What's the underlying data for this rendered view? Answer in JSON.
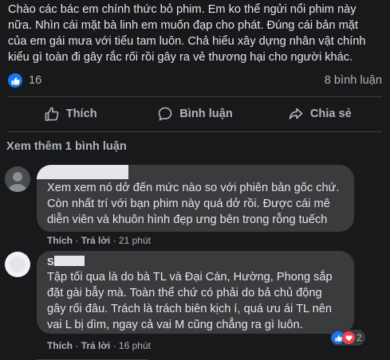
{
  "post": {
    "line1": "Chào các bác em chính thức bỏ phim. Em ko thể ngửi nổi phim này",
    "line2": "nữa. Nhìn cái mặt bà linh em muốn đạp cho phát. Đúng cái bản mặt",
    "line3": "của em gái mưa với tiểu tam luôn. Chả hiểu xây dựng nhân vật chính",
    "line4": "kiểu gì toàn đi gây rắc rối rồi gây ra vẻ thương hại cho người khác.",
    "like_count": "16",
    "comment_count": "8 bình luận"
  },
  "actions": {
    "like": "Thích",
    "comment": "Bình luận",
    "share": "Chia sẻ"
  },
  "see_more": "Xem thêm 1 bình luận",
  "comments": [
    {
      "lines": [
        "Xem xem nó dở đến mức nào so với phiên bản gốc chứ.",
        "Còn nhất trí với bạn phim này quá dở rồi. Được cái mê",
        "diễn viên và khuôn hình đẹp ưng bên trong rỗng tuếch"
      ],
      "like": "Thích",
      "reply": "Trả lời",
      "sep": "·",
      "time": "21 phút"
    },
    {
      "name_initial": "S",
      "lines": [
        "Tập tối qua là do bà TL và Đại Cán, Hường, Phong sắp",
        "đặt gài bẫy mà. Toàn thể chứ có phải do bả chủ động",
        "gây rối đâu. Trách là trách biên kịch í, quá ưu ái TL nên",
        "vai L bị dìm, ngay cả vai M cũng chẳng ra gì luôn."
      ],
      "like": "Thích",
      "reply": "Trả lời",
      "sep": "·",
      "time": "16 phút",
      "reaction_count": "2"
    }
  ],
  "colors": {
    "background": "#18191a",
    "bubble": "#3a3b3c",
    "like_blue": "#1877f2",
    "love_red": "#f33e58",
    "text": "#e4e6eb",
    "muted": "#b0b3b8"
  }
}
